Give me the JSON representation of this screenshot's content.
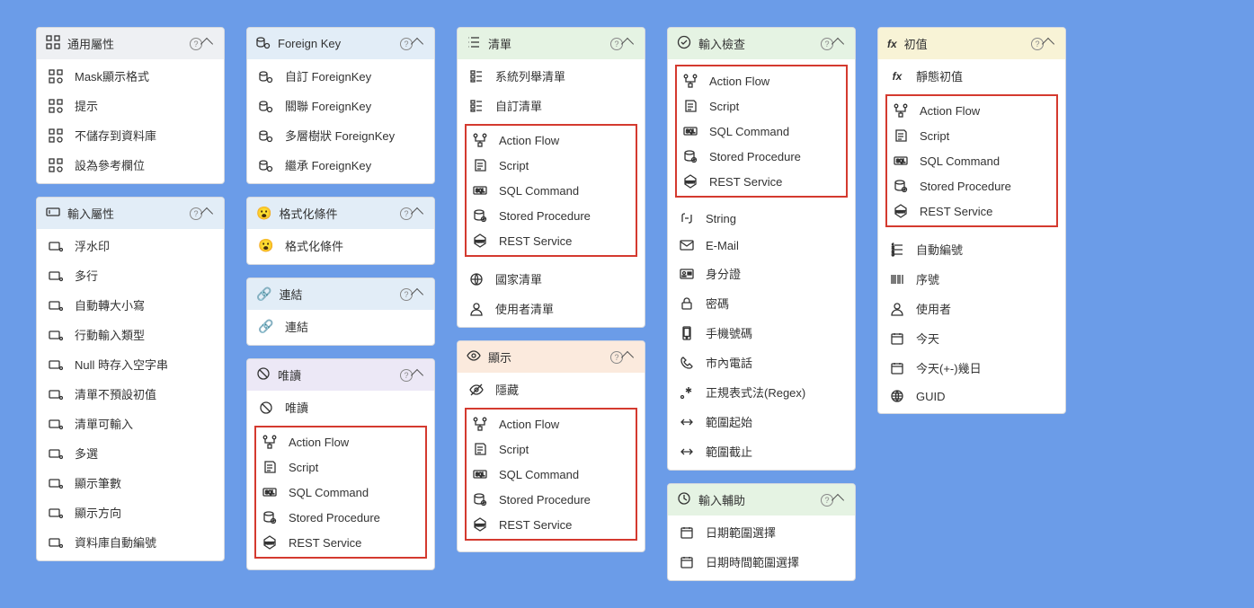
{
  "cols": [
    [
      {
        "headClass": "h-gray",
        "icon": "grid-icon",
        "title": "通用屬性",
        "items": [
          {
            "icon": "mask-icon",
            "label": "Mask顯示格式"
          },
          {
            "icon": "mask-icon",
            "label": "提示"
          },
          {
            "icon": "mask-icon",
            "label": "不儲存到資料庫"
          },
          {
            "icon": "mask-icon",
            "label": "設為參考欄位"
          }
        ]
      },
      {
        "headClass": "h-blue",
        "icon": "input-icon",
        "title": "輸入屬性",
        "items": [
          {
            "icon": "prop-icon",
            "label": "浮水印"
          },
          {
            "icon": "prop-icon",
            "label": "多行"
          },
          {
            "icon": "prop-icon",
            "label": "自動轉大小寫"
          },
          {
            "icon": "prop-icon",
            "label": "行動輸入類型"
          },
          {
            "icon": "prop-icon",
            "label": "Null 時存入空字串"
          },
          {
            "icon": "prop-icon",
            "label": "清單不預設初值"
          },
          {
            "icon": "prop-icon",
            "label": "清單可輸入"
          },
          {
            "icon": "prop-icon",
            "label": "多選"
          },
          {
            "icon": "prop-icon",
            "label": "顯示筆數"
          },
          {
            "icon": "prop-icon",
            "label": "顯示方向"
          },
          {
            "icon": "prop-icon",
            "label": "資料庫自動編號"
          }
        ]
      }
    ],
    [
      {
        "headClass": "h-blue",
        "icon": "fk-icon",
        "title": "Foreign Key",
        "items": [
          {
            "icon": "fk-icon",
            "label": "自訂 ForeignKey"
          },
          {
            "icon": "fk-icon",
            "label": "關聯 ForeignKey"
          },
          {
            "icon": "fk-icon",
            "label": "多層樹狀 ForeignKey"
          },
          {
            "icon": "fk-icon",
            "label": "繼承 ForeignKey"
          }
        ]
      },
      {
        "headClass": "h-blue",
        "icon": "emoji-icon",
        "title": "格式化條件",
        "items": [
          {
            "icon": "emoji-icon",
            "label": "格式化條件"
          }
        ]
      },
      {
        "headClass": "h-blue",
        "icon": "link-icon",
        "title": "連結",
        "items": [
          {
            "icon": "link-icon",
            "label": "連結"
          }
        ]
      },
      {
        "headClass": "h-lav",
        "icon": "readonly-icon",
        "title": "唯讀",
        "items": [
          {
            "icon": "ban-icon",
            "label": "唯讀"
          }
        ],
        "boxed": [
          {
            "icon": "flow-icon",
            "label": "Action Flow"
          },
          {
            "icon": "script-icon",
            "label": "Script"
          },
          {
            "icon": "sql-icon",
            "label": "SQL Command"
          },
          {
            "icon": "sp-icon",
            "label": "Stored Procedure"
          },
          {
            "icon": "rest-icon",
            "label": "REST Service"
          }
        ]
      }
    ],
    [
      {
        "headClass": "h-green",
        "icon": "list-icon",
        "title": "清單",
        "items": [
          {
            "icon": "enum-icon",
            "label": "系統列舉清單"
          },
          {
            "icon": "enum-icon",
            "label": "自訂清單"
          }
        ],
        "boxed": [
          {
            "icon": "flow-icon",
            "label": "Action Flow"
          },
          {
            "icon": "script-icon",
            "label": "Script"
          },
          {
            "icon": "sql-icon",
            "label": "SQL Command"
          },
          {
            "icon": "sp-icon",
            "label": "Stored Procedure"
          },
          {
            "icon": "rest-icon",
            "label": "REST Service"
          }
        ],
        "itemsAfter": [
          {
            "icon": "flag-icon",
            "label": "國家清單"
          },
          {
            "icon": "user-icon",
            "label": "使用者清單"
          }
        ]
      },
      {
        "headClass": "h-orange",
        "icon": "eye-icon",
        "title": "顯示",
        "items": [
          {
            "icon": "eyeoff-icon",
            "label": "隱藏"
          }
        ],
        "boxed": [
          {
            "icon": "flow-icon",
            "label": "Action Flow"
          },
          {
            "icon": "script-icon",
            "label": "Script"
          },
          {
            "icon": "sql-icon",
            "label": "SQL Command"
          },
          {
            "icon": "sp-icon",
            "label": "Stored Procedure"
          },
          {
            "icon": "rest-icon",
            "label": "REST Service"
          }
        ]
      }
    ],
    [
      {
        "headClass": "h-green",
        "icon": "check-icon",
        "title": "輸入檢查",
        "boxed": [
          {
            "icon": "flow-icon",
            "label": "Action Flow"
          },
          {
            "icon": "script-icon",
            "label": "Script"
          },
          {
            "icon": "sql-icon",
            "label": "SQL Command"
          },
          {
            "icon": "sp-icon",
            "label": "Stored Procedure"
          },
          {
            "icon": "rest-icon",
            "label": "REST Service"
          }
        ],
        "itemsAfter": [
          {
            "icon": "string-icon",
            "label": "String"
          },
          {
            "icon": "mail-icon",
            "label": "E-Mail"
          },
          {
            "icon": "id-icon",
            "label": "身分證"
          },
          {
            "icon": "lock-icon",
            "label": "密碼"
          },
          {
            "icon": "mobile-icon",
            "label": "手機號碼"
          },
          {
            "icon": "phone-icon",
            "label": "市內電話"
          },
          {
            "icon": "regex-icon",
            "label": "正規表式法(Regex)"
          },
          {
            "icon": "range-icon",
            "label": "範圍起始"
          },
          {
            "icon": "range-icon",
            "label": "範圍截止"
          }
        ]
      },
      {
        "headClass": "h-green",
        "icon": "clock-icon",
        "title": "輸入輔助",
        "items": [
          {
            "icon": "calendar-icon",
            "label": "日期範圍選擇"
          },
          {
            "icon": "calendar-icon",
            "label": "日期時間範圍選擇"
          }
        ]
      }
    ],
    [
      {
        "headClass": "h-yellow",
        "icon": "fx-icon",
        "title": "初值",
        "items": [
          {
            "icon": "fx-icon",
            "label": "靜態初值"
          }
        ],
        "boxed": [
          {
            "icon": "flow-icon",
            "label": "Action Flow"
          },
          {
            "icon": "script-icon",
            "label": "Script"
          },
          {
            "icon": "sql-icon",
            "label": "SQL Command"
          },
          {
            "icon": "sp-icon",
            "label": "Stored Procedure"
          },
          {
            "icon": "rest-icon",
            "label": "REST Service"
          }
        ],
        "itemsAfter": [
          {
            "icon": "auto-icon",
            "label": "自動編號"
          },
          {
            "icon": "barcode-icon",
            "label": "序號"
          },
          {
            "icon": "user-icon",
            "label": "使用者"
          },
          {
            "icon": "calendar-icon",
            "label": "今天"
          },
          {
            "icon": "calendar-icon",
            "label": "今天(+-)幾日"
          },
          {
            "icon": "guid-icon",
            "label": "GUID"
          }
        ]
      }
    ]
  ]
}
